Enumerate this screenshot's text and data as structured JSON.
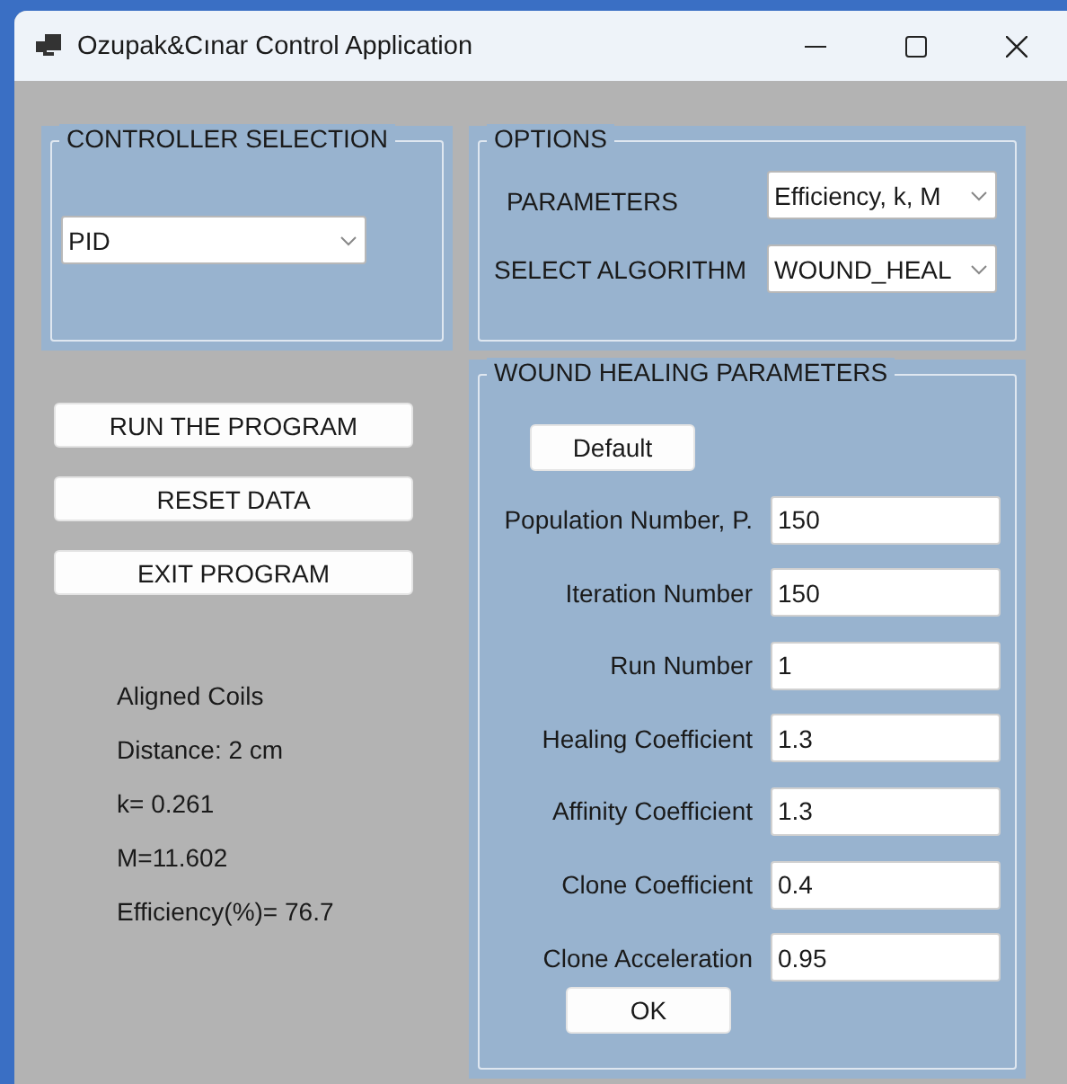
{
  "window": {
    "title": "Ozupak&Cınar Control Application"
  },
  "controller_selection": {
    "title": "CONTROLLER SELECTION",
    "value": "PID"
  },
  "options": {
    "title": "OPTIONS",
    "fields": [
      {
        "label": "PARAMETERS",
        "value": "Efficiency, k, M"
      },
      {
        "label": "SELECT ALGORITHM",
        "value": "WOUND_HEAL"
      }
    ]
  },
  "actions": [
    "RUN THE PROGRAM",
    "RESET DATA",
    "EXIT PROGRAM"
  ],
  "results": [
    "Aligned Coils",
    "Distance: 2 cm",
    "k= 0.261",
    "M=11.602",
    "Efficiency(%)= 76.7"
  ],
  "wound_healing_parameters": {
    "title": "WOUND HEALING PARAMETERS",
    "default_button": "Default",
    "fields": [
      {
        "label": "Population Number, P.",
        "value": "150"
      },
      {
        "label": "Iteration Number",
        "value": "150"
      },
      {
        "label": "Run Number",
        "value": "1"
      },
      {
        "label": "Healing Coefficient",
        "value": "1.3"
      },
      {
        "label": "Affinity Coefficient",
        "value": "1.3"
      },
      {
        "label": "Clone Coefficient",
        "value": "0.4"
      },
      {
        "label": "Clone Acceleration",
        "value": "0.95"
      }
    ],
    "ok_button": "OK"
  }
}
